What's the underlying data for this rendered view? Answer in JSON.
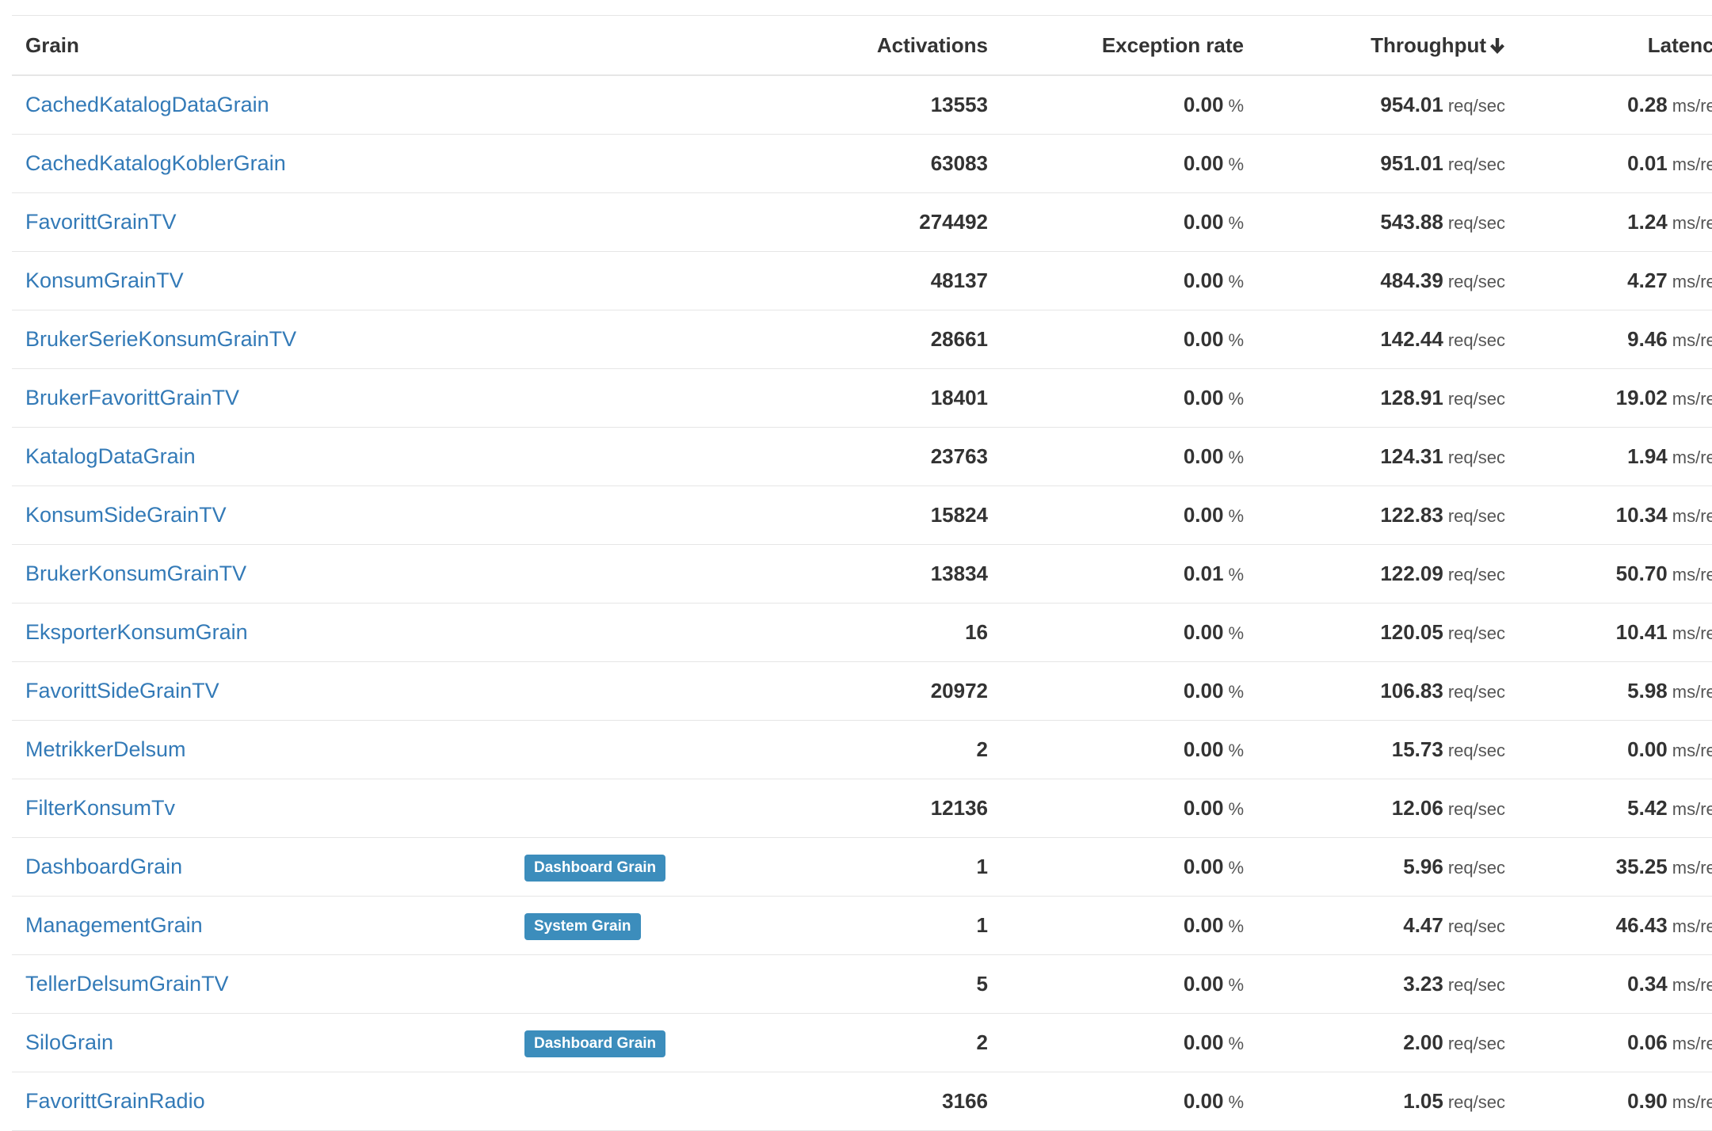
{
  "header": {
    "grain": "Grain",
    "activations": "Activations",
    "exception_rate": "Exception rate",
    "throughput": "Throughput",
    "latency": "Latency",
    "sort_icon": "arrow-down-icon"
  },
  "units": {
    "exception": "%",
    "throughput": "req/sec",
    "latency": "ms/req"
  },
  "colors": {
    "link": "#337ab7",
    "badge": "#3c8dbc"
  },
  "rows": [
    {
      "name": "CachedKatalogDataGrain",
      "badge": "",
      "activations": "13553",
      "exception": "0.00",
      "throughput": "954.01",
      "latency": "0.28"
    },
    {
      "name": "CachedKatalogKoblerGrain",
      "badge": "",
      "activations": "63083",
      "exception": "0.00",
      "throughput": "951.01",
      "latency": "0.01"
    },
    {
      "name": "FavorittGrainTV",
      "badge": "",
      "activations": "274492",
      "exception": "0.00",
      "throughput": "543.88",
      "latency": "1.24"
    },
    {
      "name": "KonsumGrainTV",
      "badge": "",
      "activations": "48137",
      "exception": "0.00",
      "throughput": "484.39",
      "latency": "4.27"
    },
    {
      "name": "BrukerSerieKonsumGrainTV",
      "badge": "",
      "activations": "28661",
      "exception": "0.00",
      "throughput": "142.44",
      "latency": "9.46"
    },
    {
      "name": "BrukerFavorittGrainTV",
      "badge": "",
      "activations": "18401",
      "exception": "0.00",
      "throughput": "128.91",
      "latency": "19.02"
    },
    {
      "name": "KatalogDataGrain",
      "badge": "",
      "activations": "23763",
      "exception": "0.00",
      "throughput": "124.31",
      "latency": "1.94"
    },
    {
      "name": "KonsumSideGrainTV",
      "badge": "",
      "activations": "15824",
      "exception": "0.00",
      "throughput": "122.83",
      "latency": "10.34"
    },
    {
      "name": "BrukerKonsumGrainTV",
      "badge": "",
      "activations": "13834",
      "exception": "0.01",
      "throughput": "122.09",
      "latency": "50.70"
    },
    {
      "name": "EksporterKonsumGrain",
      "badge": "",
      "activations": "16",
      "exception": "0.00",
      "throughput": "120.05",
      "latency": "10.41"
    },
    {
      "name": "FavorittSideGrainTV",
      "badge": "",
      "activations": "20972",
      "exception": "0.00",
      "throughput": "106.83",
      "latency": "5.98"
    },
    {
      "name": "MetrikkerDelsum",
      "badge": "",
      "activations": "2",
      "exception": "0.00",
      "throughput": "15.73",
      "latency": "0.00"
    },
    {
      "name": "FilterKonsumTv",
      "badge": "",
      "activations": "12136",
      "exception": "0.00",
      "throughput": "12.06",
      "latency": "5.42"
    },
    {
      "name": "DashboardGrain",
      "badge": "Dashboard Grain",
      "activations": "1",
      "exception": "0.00",
      "throughput": "5.96",
      "latency": "35.25"
    },
    {
      "name": "ManagementGrain",
      "badge": "System Grain",
      "activations": "1",
      "exception": "0.00",
      "throughput": "4.47",
      "latency": "46.43"
    },
    {
      "name": "TellerDelsumGrainTV",
      "badge": "",
      "activations": "5",
      "exception": "0.00",
      "throughput": "3.23",
      "latency": "0.34"
    },
    {
      "name": "SiloGrain",
      "badge": "Dashboard Grain",
      "activations": "2",
      "exception": "0.00",
      "throughput": "2.00",
      "latency": "0.06"
    },
    {
      "name": "FavorittGrainRadio",
      "badge": "",
      "activations": "3166",
      "exception": "0.00",
      "throughput": "1.05",
      "latency": "0.90"
    }
  ]
}
